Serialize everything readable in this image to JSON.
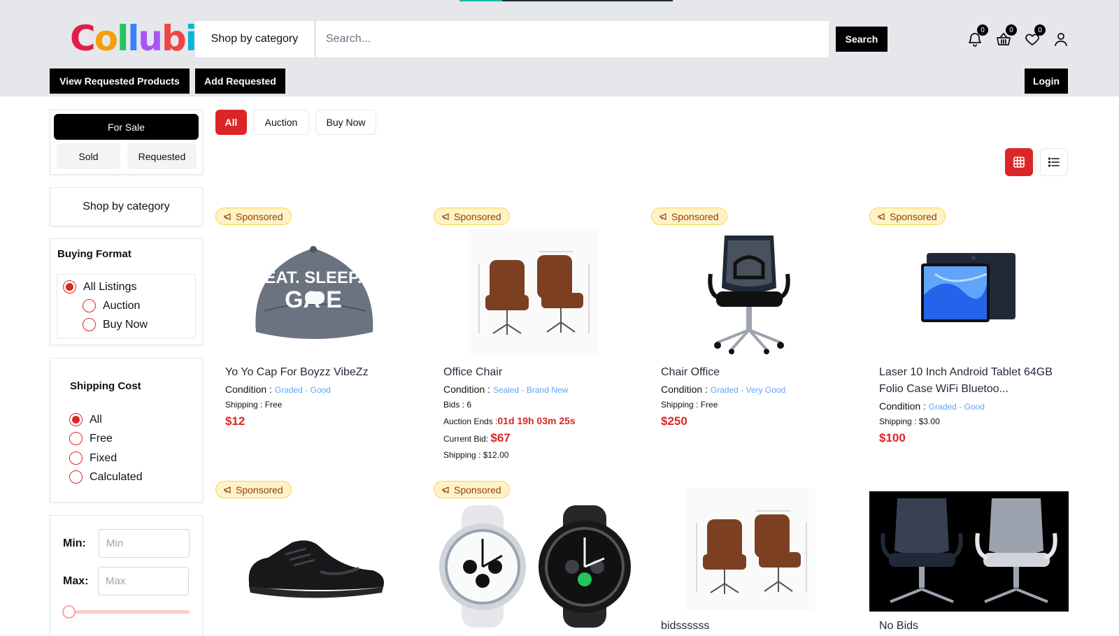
{
  "header": {
    "logo": "Collubi",
    "category_button": "Shop by category",
    "search_placeholder": "Search...",
    "search_button": "Search",
    "notifications_count": "0",
    "basket_count": "0",
    "wishlist_count": "0",
    "page_load_progress": 0.2,
    "view_requested_button": "View Requested Products",
    "add_requested_button": "Add Requested",
    "login_button": "Login"
  },
  "sidebar": {
    "for_sale": "For Sale",
    "sold": "Sold",
    "requested": "Requested",
    "shop_by_category": "Shop by category",
    "buying_format": {
      "title": "Buying Format",
      "options": [
        "All Listings",
        "Auction",
        "Buy Now"
      ],
      "selected": "All Listings"
    },
    "shipping_cost": {
      "title": "Shipping Cost",
      "options": [
        "All",
        "Free",
        "Fixed",
        "Calculated"
      ],
      "selected": "All"
    },
    "price": {
      "min_label": "Min:",
      "max_label": "Max:",
      "min_placeholder": "Min",
      "max_placeholder": "Max"
    }
  },
  "filters": {
    "tabs": [
      "All",
      "Auction",
      "Buy Now"
    ],
    "active": "All"
  },
  "products": [
    {
      "sponsored": "Sponsored",
      "title": "Yo Yo Cap For Boyzz VibeZz",
      "condition_label": "Condition :",
      "condition": "Graded - Good",
      "shipping": "Shipping : Free",
      "price": "$12"
    },
    {
      "sponsored": "Sponsored",
      "title": "Office Chair",
      "condition_label": "Condition :",
      "condition": "Sealed - Brand New",
      "bids": "Bids : 6",
      "auction_label": "Auction Ends :",
      "auction_timer": "01d  19h  03m  25s",
      "current_bid_label": "Current Bid:",
      "current_bid": "$67",
      "shipping": "Shipping : $12.00"
    },
    {
      "sponsored": "Sponsored",
      "title": "Chair Office",
      "condition_label": "Condition :",
      "condition": "Graded - Very Good",
      "shipping": "Shipping : Free",
      "price": "$250"
    },
    {
      "sponsored": "Sponsored",
      "title": "Laser 10 Inch Android Tablet 64GB Folio Case WiFi Bluetoo...",
      "condition_label": "Condition :",
      "condition": "Graded - Good",
      "shipping": "Shipping : $3.00",
      "price": "$100"
    },
    {
      "sponsored": "Sponsored",
      "title": ""
    },
    {
      "sponsored": "Sponsored",
      "title": ""
    },
    {
      "title": "bidssssss"
    },
    {
      "title": "No Bids"
    }
  ],
  "colors": {
    "accent": "#dc2626",
    "header_bg": "#e5e7eb",
    "condition_link": "#60a5fa",
    "sponsored_bg": "#fef3c7"
  }
}
